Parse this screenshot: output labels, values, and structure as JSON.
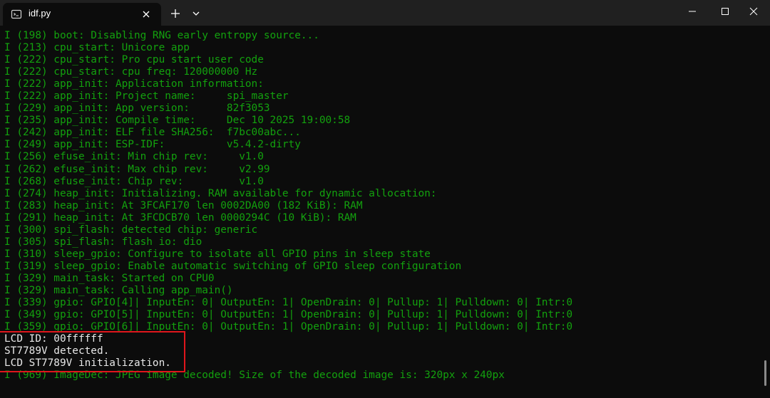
{
  "tab": {
    "title": "idf.py",
    "icon": "terminal-icon"
  },
  "titlebar_buttons": {
    "new_tab_icon": "plus-icon",
    "dropdown_icon": "chevron-down-icon",
    "minimize_icon": "minimize-icon",
    "maximize_icon": "maximize-icon",
    "close_icon": "close-icon"
  },
  "colors": {
    "log_green": "#13a10e",
    "log_white": "#e8e8e8",
    "highlight_red": "#e0161c",
    "background": "#0c0c0c"
  },
  "terminal": {
    "lines": [
      {
        "text": "I (198) boot: Disabling RNG early entropy source...",
        "style": "green"
      },
      {
        "text": "I (213) cpu_start: Unicore app",
        "style": "green"
      },
      {
        "text": "I (222) cpu_start: Pro cpu start user code",
        "style": "green"
      },
      {
        "text": "I (222) cpu_start: cpu freq: 120000000 Hz",
        "style": "green"
      },
      {
        "text": "I (222) app_init: Application information:",
        "style": "green"
      },
      {
        "text": "I (222) app_init: Project name:     spi_master",
        "style": "green"
      },
      {
        "text": "I (229) app_init: App version:      82f3053",
        "style": "green"
      },
      {
        "text": "I (235) app_init: Compile time:     Dec 10 2025 19:00:58",
        "style": "green"
      },
      {
        "text": "I (242) app_init: ELF file SHA256:  f7bc00abc...",
        "style": "green"
      },
      {
        "text": "I (249) app_init: ESP-IDF:          v5.4.2-dirty",
        "style": "green"
      },
      {
        "text": "I (256) efuse_init: Min chip rev:     v1.0",
        "style": "green"
      },
      {
        "text": "I (262) efuse_init: Max chip rev:     v2.99",
        "style": "green"
      },
      {
        "text": "I (268) efuse_init: Chip rev:         v1.0",
        "style": "green"
      },
      {
        "text": "I (274) heap_init: Initializing. RAM available for dynamic allocation:",
        "style": "green"
      },
      {
        "text": "I (283) heap_init: At 3FCAF170 len 0002DA00 (182 KiB): RAM",
        "style": "green"
      },
      {
        "text": "I (291) heap_init: At 3FCDCB70 len 0000294C (10 KiB): RAM",
        "style": "green"
      },
      {
        "text": "I (300) spi_flash: detected chip: generic",
        "style": "green"
      },
      {
        "text": "I (305) spi_flash: flash io: dio",
        "style": "green"
      },
      {
        "text": "I (310) sleep_gpio: Configure to isolate all GPIO pins in sleep state",
        "style": "green"
      },
      {
        "text": "I (319) sleep_gpio: Enable automatic switching of GPIO sleep configuration",
        "style": "green"
      },
      {
        "text": "I (329) main_task: Started on CPU0",
        "style": "green"
      },
      {
        "text": "I (329) main_task: Calling app_main()",
        "style": "green"
      },
      {
        "text": "I (339) gpio: GPIO[4]| InputEn: 0| OutputEn: 1| OpenDrain: 0| Pullup: 1| Pulldown: 0| Intr:0",
        "style": "green"
      },
      {
        "text": "I (349) gpio: GPIO[5]| InputEn: 0| OutputEn: 1| OpenDrain: 0| Pullup: 1| Pulldown: 0| Intr:0",
        "style": "green"
      },
      {
        "text": "I (359) gpio: GPIO[6]| InputEn: 0| OutputEn: 1| OpenDrain: 0| Pullup: 1| Pulldown: 0| Intr:0",
        "style": "green"
      },
      {
        "text": "LCD ID: 00ffffff",
        "style": "white"
      },
      {
        "text": "ST7789V detected.",
        "style": "white"
      },
      {
        "text": "LCD ST7789V initialization.",
        "style": "white"
      },
      {
        "text": "I (969) ImageDec: JPEG image decoded! Size of the decoded image is: 320px x 240px",
        "style": "green"
      }
    ]
  }
}
